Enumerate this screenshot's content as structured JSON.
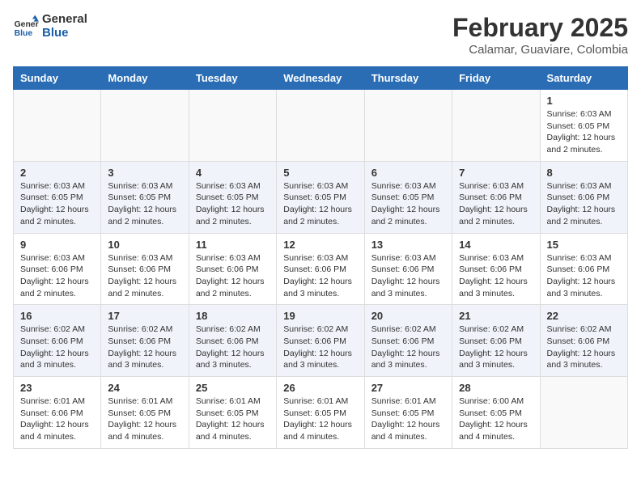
{
  "header": {
    "logo_line1": "General",
    "logo_line2": "Blue",
    "title": "February 2025",
    "subtitle": "Calamar, Guaviare, Colombia"
  },
  "weekdays": [
    "Sunday",
    "Monday",
    "Tuesday",
    "Wednesday",
    "Thursday",
    "Friday",
    "Saturday"
  ],
  "weeks": [
    [
      {
        "day": "",
        "info": ""
      },
      {
        "day": "",
        "info": ""
      },
      {
        "day": "",
        "info": ""
      },
      {
        "day": "",
        "info": ""
      },
      {
        "day": "",
        "info": ""
      },
      {
        "day": "",
        "info": ""
      },
      {
        "day": "1",
        "info": "Sunrise: 6:03 AM\nSunset: 6:05 PM\nDaylight: 12 hours\nand 2 minutes."
      }
    ],
    [
      {
        "day": "2",
        "info": "Sunrise: 6:03 AM\nSunset: 6:05 PM\nDaylight: 12 hours\nand 2 minutes."
      },
      {
        "day": "3",
        "info": "Sunrise: 6:03 AM\nSunset: 6:05 PM\nDaylight: 12 hours\nand 2 minutes."
      },
      {
        "day": "4",
        "info": "Sunrise: 6:03 AM\nSunset: 6:05 PM\nDaylight: 12 hours\nand 2 minutes."
      },
      {
        "day": "5",
        "info": "Sunrise: 6:03 AM\nSunset: 6:05 PM\nDaylight: 12 hours\nand 2 minutes."
      },
      {
        "day": "6",
        "info": "Sunrise: 6:03 AM\nSunset: 6:05 PM\nDaylight: 12 hours\nand 2 minutes."
      },
      {
        "day": "7",
        "info": "Sunrise: 6:03 AM\nSunset: 6:06 PM\nDaylight: 12 hours\nand 2 minutes."
      },
      {
        "day": "8",
        "info": "Sunrise: 6:03 AM\nSunset: 6:06 PM\nDaylight: 12 hours\nand 2 minutes."
      }
    ],
    [
      {
        "day": "9",
        "info": "Sunrise: 6:03 AM\nSunset: 6:06 PM\nDaylight: 12 hours\nand 2 minutes."
      },
      {
        "day": "10",
        "info": "Sunrise: 6:03 AM\nSunset: 6:06 PM\nDaylight: 12 hours\nand 2 minutes."
      },
      {
        "day": "11",
        "info": "Sunrise: 6:03 AM\nSunset: 6:06 PM\nDaylight: 12 hours\nand 2 minutes."
      },
      {
        "day": "12",
        "info": "Sunrise: 6:03 AM\nSunset: 6:06 PM\nDaylight: 12 hours\nand 3 minutes."
      },
      {
        "day": "13",
        "info": "Sunrise: 6:03 AM\nSunset: 6:06 PM\nDaylight: 12 hours\nand 3 minutes."
      },
      {
        "day": "14",
        "info": "Sunrise: 6:03 AM\nSunset: 6:06 PM\nDaylight: 12 hours\nand 3 minutes."
      },
      {
        "day": "15",
        "info": "Sunrise: 6:03 AM\nSunset: 6:06 PM\nDaylight: 12 hours\nand 3 minutes."
      }
    ],
    [
      {
        "day": "16",
        "info": "Sunrise: 6:02 AM\nSunset: 6:06 PM\nDaylight: 12 hours\nand 3 minutes."
      },
      {
        "day": "17",
        "info": "Sunrise: 6:02 AM\nSunset: 6:06 PM\nDaylight: 12 hours\nand 3 minutes."
      },
      {
        "day": "18",
        "info": "Sunrise: 6:02 AM\nSunset: 6:06 PM\nDaylight: 12 hours\nand 3 minutes."
      },
      {
        "day": "19",
        "info": "Sunrise: 6:02 AM\nSunset: 6:06 PM\nDaylight: 12 hours\nand 3 minutes."
      },
      {
        "day": "20",
        "info": "Sunrise: 6:02 AM\nSunset: 6:06 PM\nDaylight: 12 hours\nand 3 minutes."
      },
      {
        "day": "21",
        "info": "Sunrise: 6:02 AM\nSunset: 6:06 PM\nDaylight: 12 hours\nand 3 minutes."
      },
      {
        "day": "22",
        "info": "Sunrise: 6:02 AM\nSunset: 6:06 PM\nDaylight: 12 hours\nand 3 minutes."
      }
    ],
    [
      {
        "day": "23",
        "info": "Sunrise: 6:01 AM\nSunset: 6:06 PM\nDaylight: 12 hours\nand 4 minutes."
      },
      {
        "day": "24",
        "info": "Sunrise: 6:01 AM\nSunset: 6:05 PM\nDaylight: 12 hours\nand 4 minutes."
      },
      {
        "day": "25",
        "info": "Sunrise: 6:01 AM\nSunset: 6:05 PM\nDaylight: 12 hours\nand 4 minutes."
      },
      {
        "day": "26",
        "info": "Sunrise: 6:01 AM\nSunset: 6:05 PM\nDaylight: 12 hours\nand 4 minutes."
      },
      {
        "day": "27",
        "info": "Sunrise: 6:01 AM\nSunset: 6:05 PM\nDaylight: 12 hours\nand 4 minutes."
      },
      {
        "day": "28",
        "info": "Sunrise: 6:00 AM\nSunset: 6:05 PM\nDaylight: 12 hours\nand 4 minutes."
      },
      {
        "day": "",
        "info": ""
      }
    ]
  ]
}
